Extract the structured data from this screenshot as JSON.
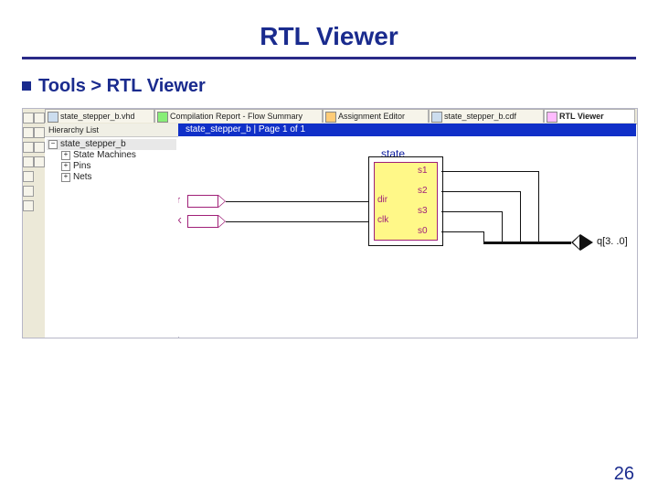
{
  "slide": {
    "title": "RTL Viewer",
    "bullet": "Tools > RTL Viewer",
    "page_number": "26"
  },
  "tabs": [
    {
      "label": "state_stepper_b.vhd"
    },
    {
      "label": "Compilation Report - Flow Summary"
    },
    {
      "label": "Assignment Editor"
    },
    {
      "label": "state_stepper_b.cdf"
    },
    {
      "label": "RTL Viewer",
      "current": true
    }
  ],
  "hierarchy": {
    "header": "Hierarchy List",
    "root": "state_stepper_b",
    "children": [
      "State Machines",
      "Pins",
      "Nets"
    ]
  },
  "canvas": {
    "header": "state_stepper_b | Page 1 of 1"
  },
  "schematic": {
    "block_title": "state",
    "inputs": [
      "dir",
      "clk"
    ],
    "inner_left": [
      "dir",
      "clk"
    ],
    "inner_right": [
      "s1",
      "s2",
      "s3",
      "s0"
    ],
    "output": "q[3. .0]"
  }
}
